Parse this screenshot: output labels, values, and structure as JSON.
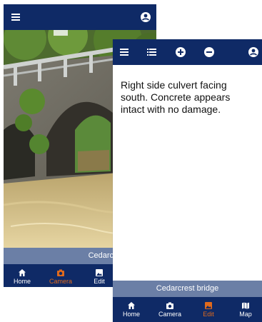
{
  "screen_camera": {
    "caption": "Cedarcrest bridge",
    "nav": [
      {
        "label": "Home",
        "icon": "home-icon",
        "active": false
      },
      {
        "label": "Camera",
        "icon": "camera-icon",
        "active": true
      },
      {
        "label": "Edit",
        "icon": "image-icon",
        "active": false
      }
    ],
    "header_icons": [
      "menu-icon",
      "account-icon"
    ]
  },
  "screen_edit": {
    "description": "Right side culvert facing south. Concrete appears intact with no damage.",
    "caption": "Cedarcrest bridge",
    "nav": [
      {
        "label": "Home",
        "icon": "home-icon",
        "active": false
      },
      {
        "label": "Camera",
        "icon": "camera-icon",
        "active": false
      },
      {
        "label": "Edit",
        "icon": "image-icon",
        "active": true
      },
      {
        "label": "Map",
        "icon": "map-icon",
        "active": false
      }
    ],
    "header_icons": [
      "menu-icon",
      "list-icon",
      "zoom-in-icon",
      "zoom-out-icon",
      "account-icon"
    ]
  },
  "colors": {
    "header": "#0f2a66",
    "caption_bar": "#6b7fa6",
    "active": "#e06a1c"
  }
}
